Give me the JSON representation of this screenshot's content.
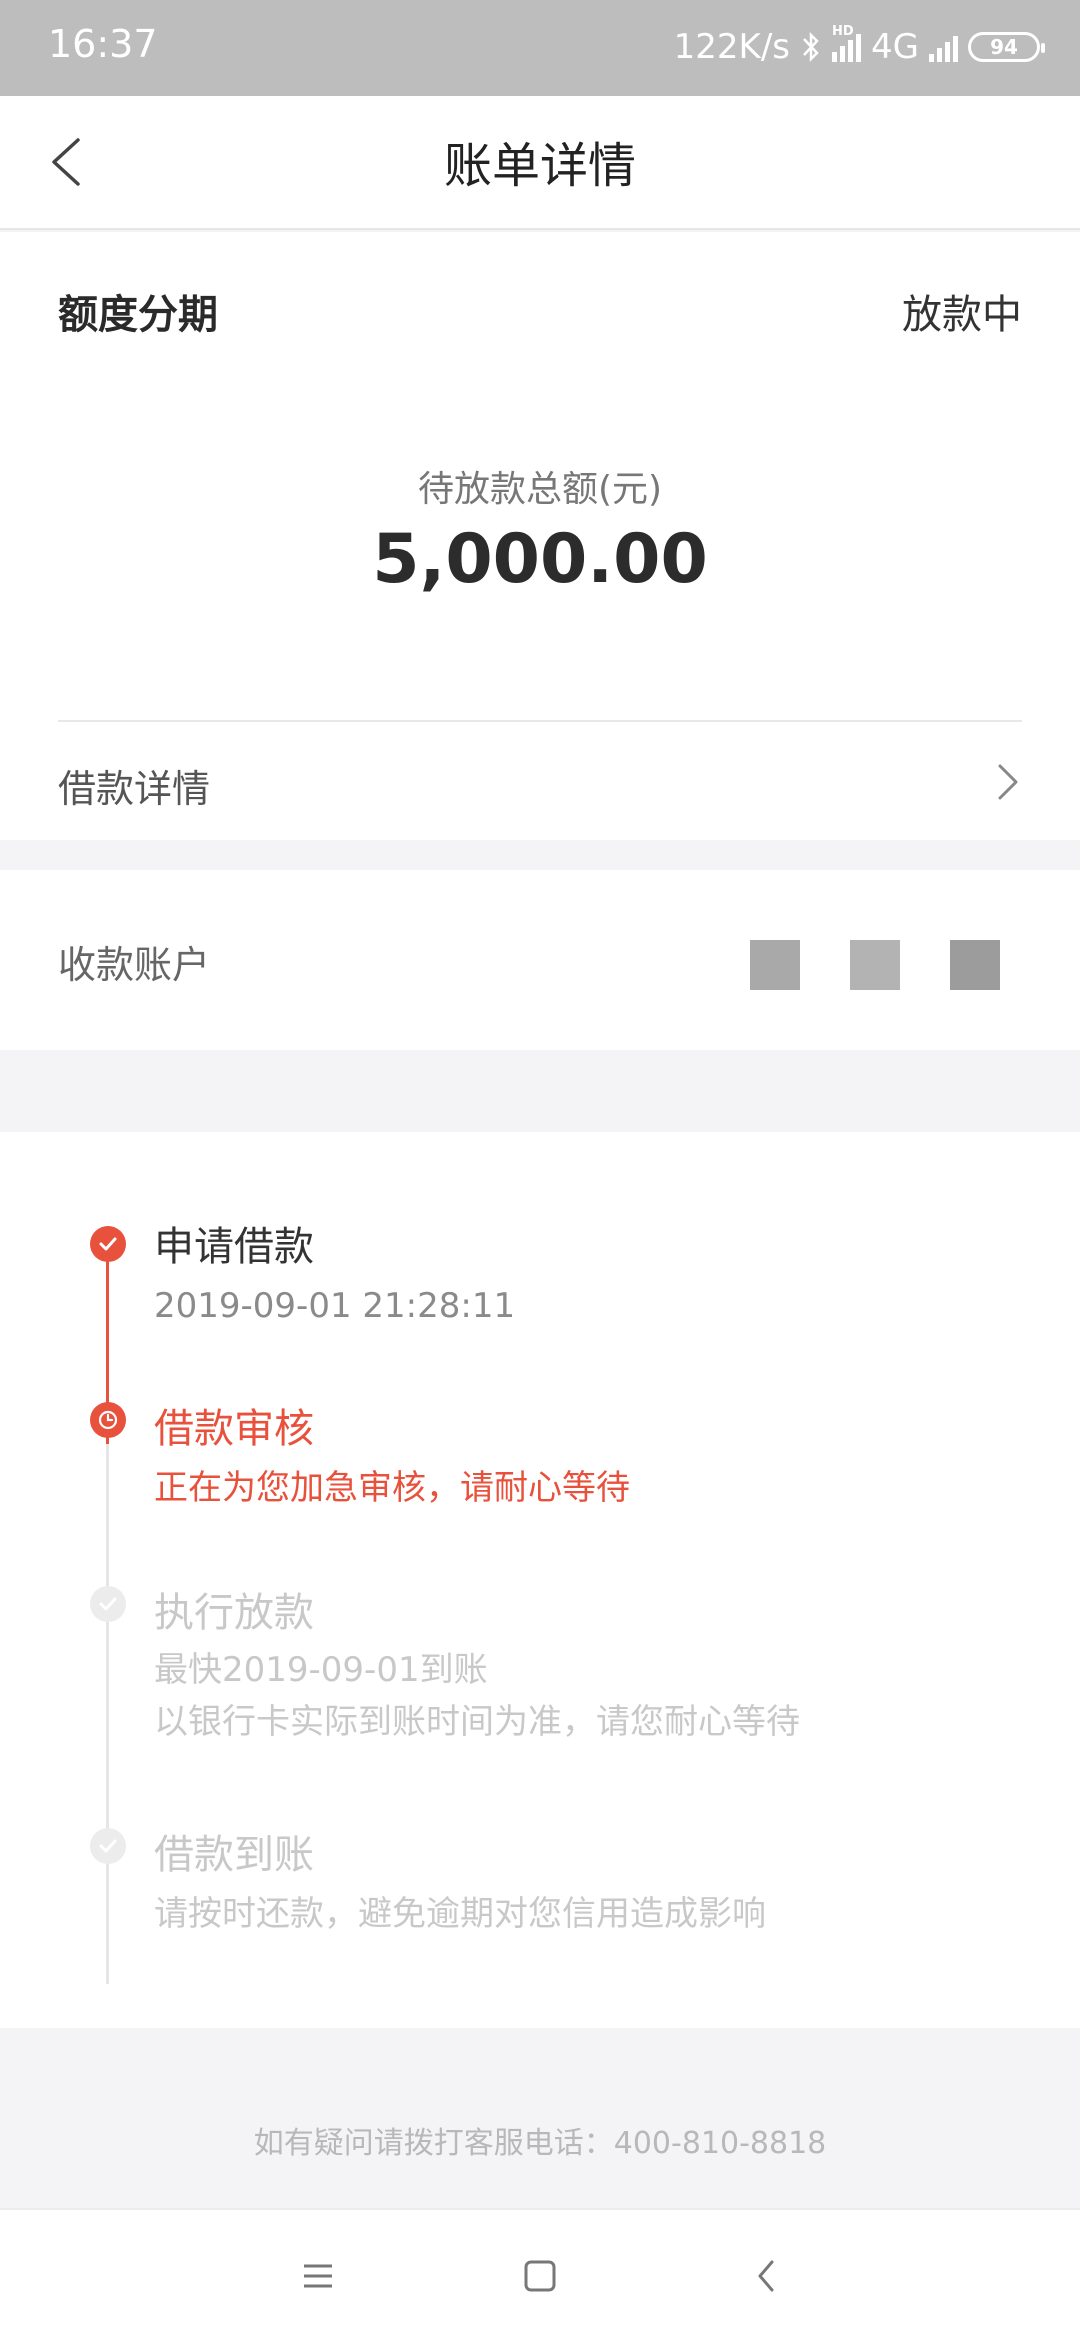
{
  "status_bar": {
    "time": "16:37",
    "speed": "122K/s",
    "hd": "HD",
    "network": "4G",
    "battery": "94"
  },
  "header": {
    "back_icon": "chevron-left-icon",
    "title": "账单详情"
  },
  "bill": {
    "type": "额度分期",
    "status": "放款中",
    "amount_label": "待放款总额(元)",
    "amount": "5,000.00",
    "detail_label": "借款详情"
  },
  "account": {
    "label": "收款账户"
  },
  "timeline": [
    {
      "title": "申请借款",
      "desc": [
        "2019-09-01 21:28:11"
      ],
      "state": "done"
    },
    {
      "title": "借款审核",
      "desc": [
        "正在为您加急审核，请耐心等待"
      ],
      "state": "current"
    },
    {
      "title": "执行放款",
      "desc": [
        "最快2019-09-01到账",
        "以银行卡实际到账时间为准，请您耐心等待"
      ],
      "state": "pending"
    },
    {
      "title": "借款到账",
      "desc": [
        "请按时还款，避免逾期对您信用造成影响"
      ],
      "state": "pending"
    }
  ],
  "footer": {
    "note": "如有疑问请拨打客服电话：400-810-8818"
  },
  "colors": {
    "accent": "#e8513b",
    "pending": "#c8c8c8"
  }
}
